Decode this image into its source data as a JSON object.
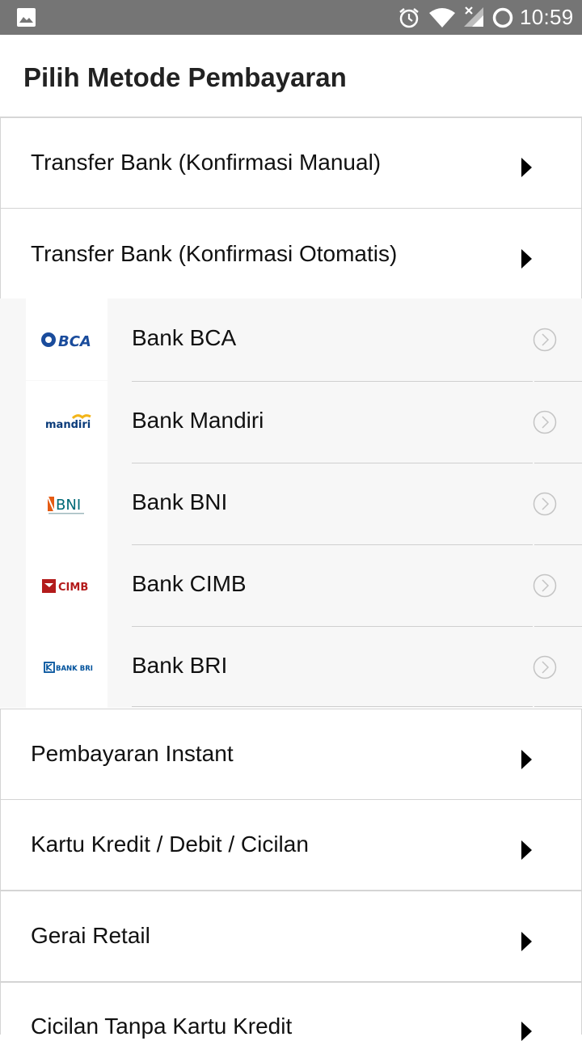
{
  "status_bar": {
    "time": "10:59",
    "icons": [
      "gallery-icon",
      "alarm-icon",
      "wifi-icon",
      "signal-icon",
      "battery-icon"
    ]
  },
  "header": {
    "title": "Pilih Metode Pembayaran"
  },
  "methods": [
    {
      "label": "Transfer Bank (Konfirmasi Manual)"
    },
    {
      "label": "Transfer Bank (Konfirmasi Otomatis)"
    },
    {
      "label": "Pembayaran Instant"
    },
    {
      "label": "Kartu Kredit / Debit / Cicilan"
    },
    {
      "label": "Gerai Retail"
    },
    {
      "label": "Cicilan Tanpa Kartu Kredit"
    }
  ],
  "banks": [
    {
      "name": "Bank BCA",
      "logo_text": "BCA"
    },
    {
      "name": "Bank Mandiri",
      "logo_text": "mandiri"
    },
    {
      "name": "Bank BNI",
      "logo_text": "BNI"
    },
    {
      "name": "Bank CIMB",
      "logo_text": "CIMB"
    },
    {
      "name": "Bank BRI",
      "logo_text": "BANK BRI"
    }
  ],
  "colors": {
    "status_bar": "#757575",
    "bca_blue": "#1a4c9c",
    "mandiri_blue": "#0a3b7a",
    "mandiri_gold": "#f3b51a",
    "bni_orange": "#e55b13",
    "bni_teal": "#006a77",
    "cimb_red": "#b31b1b",
    "bri_blue": "#00529c"
  }
}
